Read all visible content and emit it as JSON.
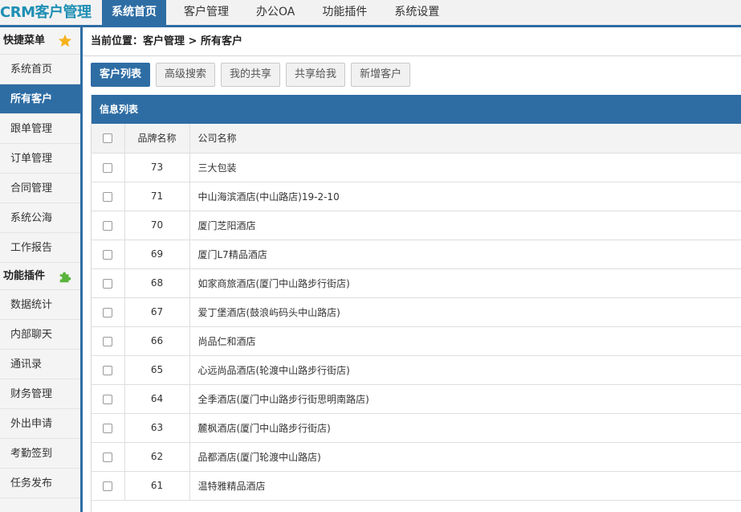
{
  "app": {
    "logo": "CRM客户管理"
  },
  "topnav": [
    {
      "label": "系统首页",
      "active": true
    },
    {
      "label": "客户管理"
    },
    {
      "label": "办公OA"
    },
    {
      "label": "功能插件"
    },
    {
      "label": "系统设置"
    }
  ],
  "sidebar": {
    "quick_title": "快捷菜单",
    "quick_items": [
      "系统首页",
      "所有客户",
      "跟单管理",
      "订单管理",
      "合同管理",
      "系统公海",
      "工作报告"
    ],
    "plugin_title": "功能插件",
    "plugin_items": [
      "数据统计",
      "内部聊天",
      "通讯录",
      "财务管理",
      "外出申请",
      "考勤签到",
      "任务发布"
    ]
  },
  "breadcrumb": "当前位置：客户管理 > 所有客户",
  "toolbar": [
    "客户列表",
    "高级搜索",
    "我的共享",
    "共享给我",
    "新增客户"
  ],
  "panel": {
    "title": "信息列表"
  },
  "table": {
    "headers": [
      "品牌名称",
      "公司名称"
    ],
    "rows": [
      [
        "73",
        "三大包装"
      ],
      [
        "71",
        "中山海滨酒店(中山路店)19-2-10"
      ],
      [
        "70",
        "厦门芝阳酒店"
      ],
      [
        "69",
        "厦门L7精品酒店"
      ],
      [
        "68",
        "如家商旅酒店(厦门中山路步行街店)"
      ],
      [
        "67",
        "爱丁堡酒店(鼓浪屿码头中山路店)"
      ],
      [
        "66",
        "尚品仁和酒店"
      ],
      [
        "65",
        "心远尚品酒店(轮渡中山路步行街店)"
      ],
      [
        "64",
        "全季酒店(厦门中山路步行街思明南路店)"
      ],
      [
        "63",
        "麓枫酒店(厦门中山路步行街店)"
      ],
      [
        "62",
        "品都酒店(厦门轮渡中山路店)"
      ],
      [
        "61",
        "温特雅精品酒店"
      ]
    ]
  },
  "colors": {
    "accent": "#2e6da4",
    "logo": "#1f8fb4",
    "star": "#f5b21b",
    "puzzle": "#5ab43c"
  },
  "icons": {
    "quick": "star-icon",
    "plugin": "puzzle-icon"
  }
}
